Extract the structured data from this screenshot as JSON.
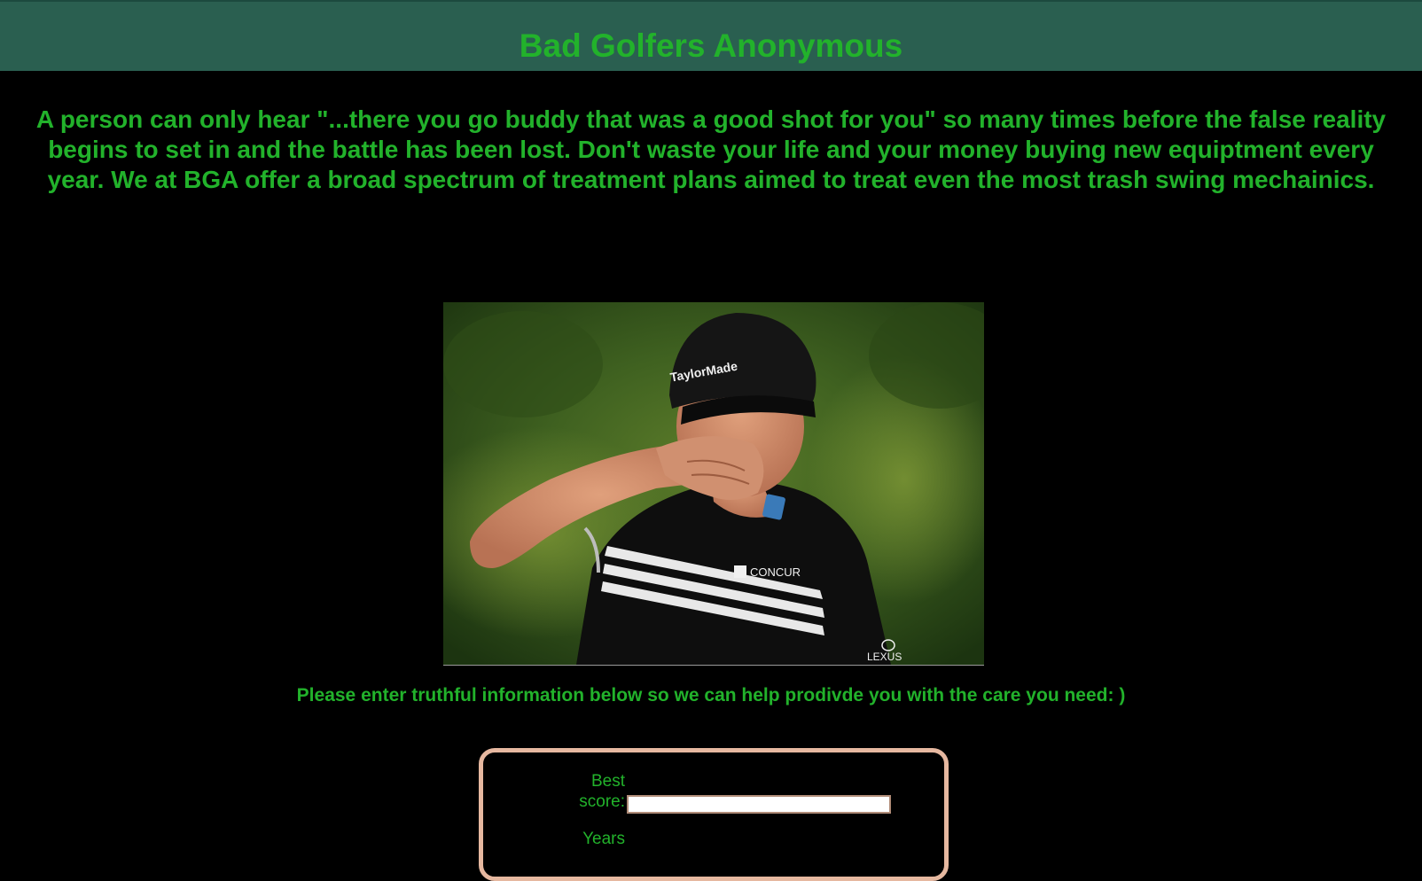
{
  "header": {
    "title": "Bad Golfers Anonymous"
  },
  "intro": {
    "text": "A person can only hear \"...there you go buddy that was a good shot for you\" so many times before the false reality begins to set in and the battle has been lost. Don't waste your life and your money buying new equiptment every year. We at BGA offer a broad spectrum of treatment plans aimed to treat even the most trash swing mechainics."
  },
  "photo": {
    "cap_logo": "TaylorMade",
    "shirt_logo": "CONCUR",
    "car_logo": "LEXUS"
  },
  "form": {
    "prompt": "Please enter truthful information below so we can help prodivde you with the care you need: )",
    "fields": [
      {
        "label_line1": "Best",
        "label_line2": "score:",
        "value": ""
      },
      {
        "label_line1": "Years",
        "label_line2": ""
      }
    ]
  },
  "colors": {
    "accent_green": "#22b22b",
    "header_bg": "#2a5f50",
    "page_bg": "#000000",
    "form_border": "#e6b8a0"
  }
}
